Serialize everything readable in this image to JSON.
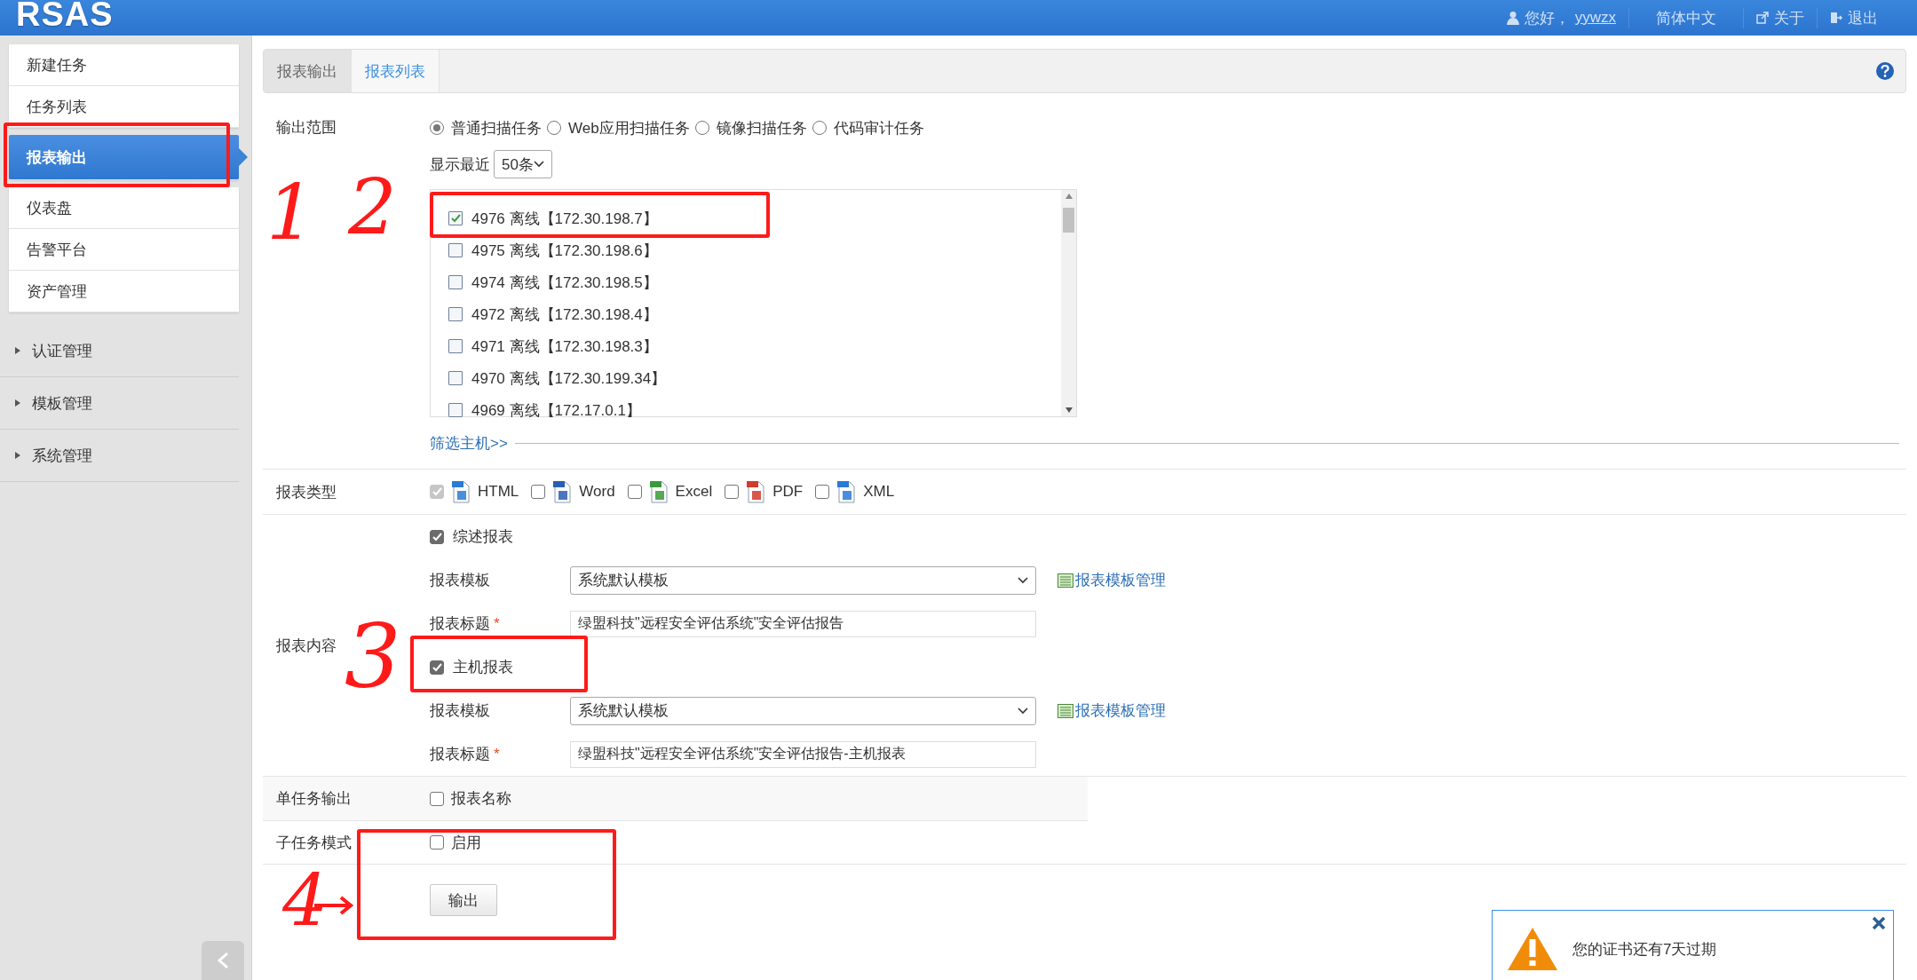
{
  "header": {
    "logo": "RSAS",
    "greeting": "您好，",
    "username": "yywzx",
    "language": "简体中文",
    "about": "关于",
    "logout": "退出"
  },
  "sidebar": {
    "menu": [
      {
        "label": "新建任务",
        "selected": false
      },
      {
        "label": "任务列表",
        "selected": false
      },
      {
        "label": "报表输出",
        "selected": true
      },
      {
        "label": "仪表盘",
        "selected": false
      },
      {
        "label": "告警平台",
        "selected": false
      },
      {
        "label": "资产管理",
        "selected": false
      }
    ],
    "groups": [
      {
        "label": "认证管理",
        "expanded": false
      },
      {
        "label": "模板管理",
        "expanded": false
      },
      {
        "label": "系统管理",
        "expanded": false
      }
    ]
  },
  "tabs": [
    {
      "label": "报表输出",
      "selected": true
    },
    {
      "label": "报表列表",
      "selected": false
    }
  ],
  "form": {
    "scope": {
      "label": "输出范围",
      "options": [
        {
          "label": "普通扫描任务",
          "selected": true
        },
        {
          "label": "Web应用扫描任务",
          "selected": false
        },
        {
          "label": "镜像扫描任务",
          "selected": false
        },
        {
          "label": "代码审计任务",
          "selected": false
        }
      ],
      "recent_label": "显示最近",
      "recent_value": "50条",
      "hosts": [
        {
          "text": "4976 离线【172.30.198.7】",
          "checked": true
        },
        {
          "text": "4975 离线【172.30.198.6】",
          "checked": false
        },
        {
          "text": "4974 离线【172.30.198.5】",
          "checked": false
        },
        {
          "text": "4972 离线【172.30.198.4】",
          "checked": false
        },
        {
          "text": "4971 离线【172.30.198.3】",
          "checked": false
        },
        {
          "text": "4970 离线【172.30.199.34】",
          "checked": false
        },
        {
          "text": "4969 离线【172.17.0.1】",
          "checked": false
        }
      ],
      "filter_link": "筛选主机>>"
    },
    "report_type": {
      "label": "报表类型",
      "types": [
        {
          "kind": "html",
          "label": "HTML",
          "checked": true,
          "disabled": true
        },
        {
          "kind": "word",
          "label": "Word",
          "checked": false,
          "disabled": false
        },
        {
          "kind": "excel",
          "label": "Excel",
          "checked": false,
          "disabled": false
        },
        {
          "kind": "pdf",
          "label": "PDF",
          "checked": false,
          "disabled": false
        },
        {
          "kind": "xml",
          "label": "XML",
          "checked": false,
          "disabled": false
        }
      ]
    },
    "content": {
      "label": "报表内容",
      "sections": [
        {
          "label": "综述报表",
          "checked": true,
          "template_label": "报表模板",
          "template": "系统默认模板",
          "manage_link": "报表模板管理",
          "title_label": "报表标题",
          "required_mark": "*",
          "title_value": "绿盟科技\"远程安全评估系统\"安全评估报告"
        },
        {
          "label": "主机报表",
          "checked": true,
          "template_label": "报表模板",
          "template": "系统默认模板",
          "manage_link": "报表模板管理",
          "title_label": "报表标题",
          "required_mark": "*",
          "title_value": "绿盟科技\"远程安全评估系统\"安全评估报告-主机报表"
        }
      ]
    },
    "single_task": {
      "label": "单任务输出",
      "option": "报表名称",
      "checked": false
    },
    "subtask": {
      "label": "子任务模式",
      "option": "启用",
      "checked": false
    },
    "submit": "输出"
  },
  "notification": {
    "message": "您的证书还有7天过期"
  },
  "annotations": [
    {
      "label": "1"
    },
    {
      "label": "2"
    },
    {
      "label": "3"
    },
    {
      "label": "4"
    }
  ]
}
